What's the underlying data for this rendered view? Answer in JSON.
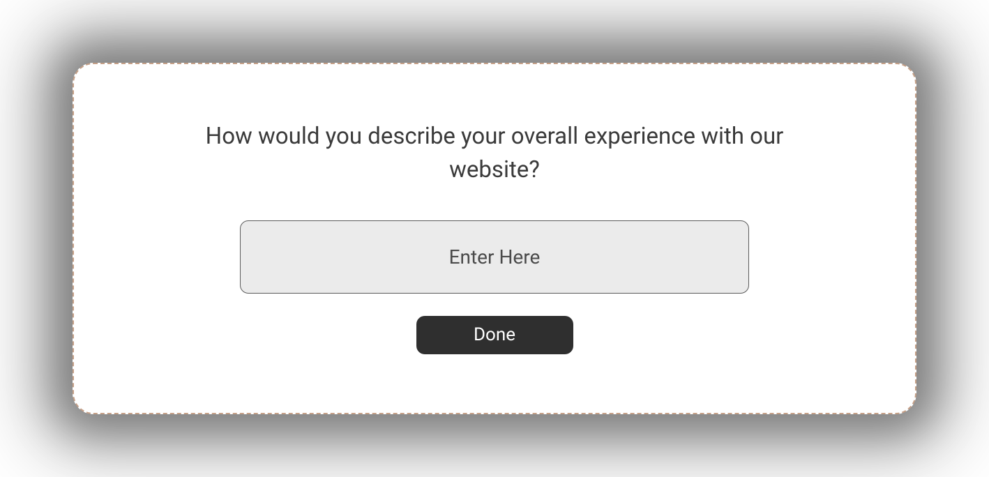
{
  "survey": {
    "question": "How would you describe your overall experience with our website?",
    "input_placeholder": "Enter Here",
    "input_value": "",
    "submit_label": "Done"
  }
}
